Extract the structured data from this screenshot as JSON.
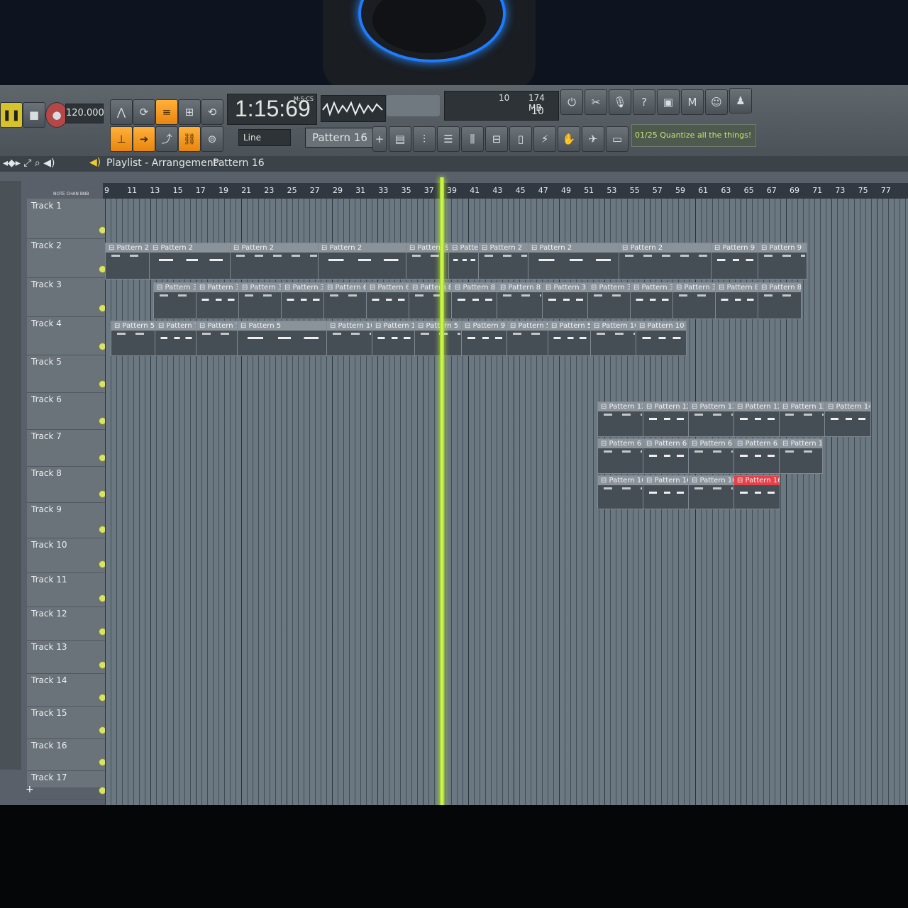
{
  "transport": {
    "tempo": "120.000",
    "time_display": "1:15:69",
    "time_format": "M:S:CS",
    "cpu_value": "10",
    "memory": "174 MB",
    "polyphony": "10"
  },
  "toolbar": {
    "snap_mode": "Line",
    "pattern_selector": "Pattern 16",
    "hint_text": "01/25 Quantize all the things!"
  },
  "playlist": {
    "title": "Playlist - Arrangement",
    "current_pattern": "Pattern 16"
  },
  "ruler_labels": [
    "NOTE",
    "CHAN",
    "BNB"
  ],
  "bars": [
    "9",
    "11",
    "13",
    "15",
    "17",
    "19",
    "21",
    "23",
    "25",
    "27",
    "29",
    "31",
    "33",
    "35",
    "37",
    "39",
    "41",
    "43",
    "45",
    "47",
    "49",
    "51",
    "53",
    "55",
    "57",
    "59",
    "61",
    "63",
    "65",
    "67",
    "69",
    "71",
    "73",
    "75",
    "77"
  ],
  "tracks": [
    "Track 1",
    "Track 2",
    "Track 3",
    "Track 4",
    "Track 5",
    "Track 6",
    "Track 7",
    "Track 8",
    "Track 9",
    "Track 10",
    "Track 11",
    "Track 12",
    "Track 13",
    "Track 14",
    "Track 15",
    "Track 16",
    "Track 17"
  ],
  "clips": {
    "track2": [
      "Pattern 2",
      "Pattern 2",
      "Pattern 2",
      "Pattern 2",
      "Pattern 9",
      "Pattern 9",
      "Pattern 2",
      "Pattern 2",
      "Pattern 2",
      "Pattern 9",
      "Pattern 9"
    ],
    "track3": [
      "Pattern 3",
      "Pattern 3",
      "Pattern 3",
      "Pattern 3",
      "Pattern 6",
      "Pattern 6",
      "Pattern 8",
      "Pattern 8",
      "Pattern 8",
      "Pattern 3",
      "Pattern 3",
      "Pattern 3",
      "Pattern 3",
      "Pattern 8",
      "Pattern 8"
    ],
    "track4": [
      "Pattern 5",
      "Pattern 7",
      "Pattern 7",
      "Pattern 5",
      "Pattern 10",
      "Pattern 10",
      "Pattern 5",
      "Pattern 9",
      "Pattern 5",
      "Pattern 5",
      "Pattern 10",
      "Pattern 10"
    ],
    "track6": [
      "Pattern 12",
      "Pattern 12",
      "Pattern 12",
      "Pattern 12",
      "Pattern 13",
      "Pattern 14"
    ],
    "track7": [
      "Pattern 6",
      "Pattern 6",
      "Pattern 6",
      "Pattern 6",
      "Pattern 14"
    ],
    "track8": [
      "Pattern 16",
      "Pattern 16",
      "Pattern 16",
      "Pattern 16"
    ]
  },
  "colors": {
    "accent": "#ff9b1a",
    "playhead": "#c8f23c",
    "selected_clip": "#e4414a"
  }
}
